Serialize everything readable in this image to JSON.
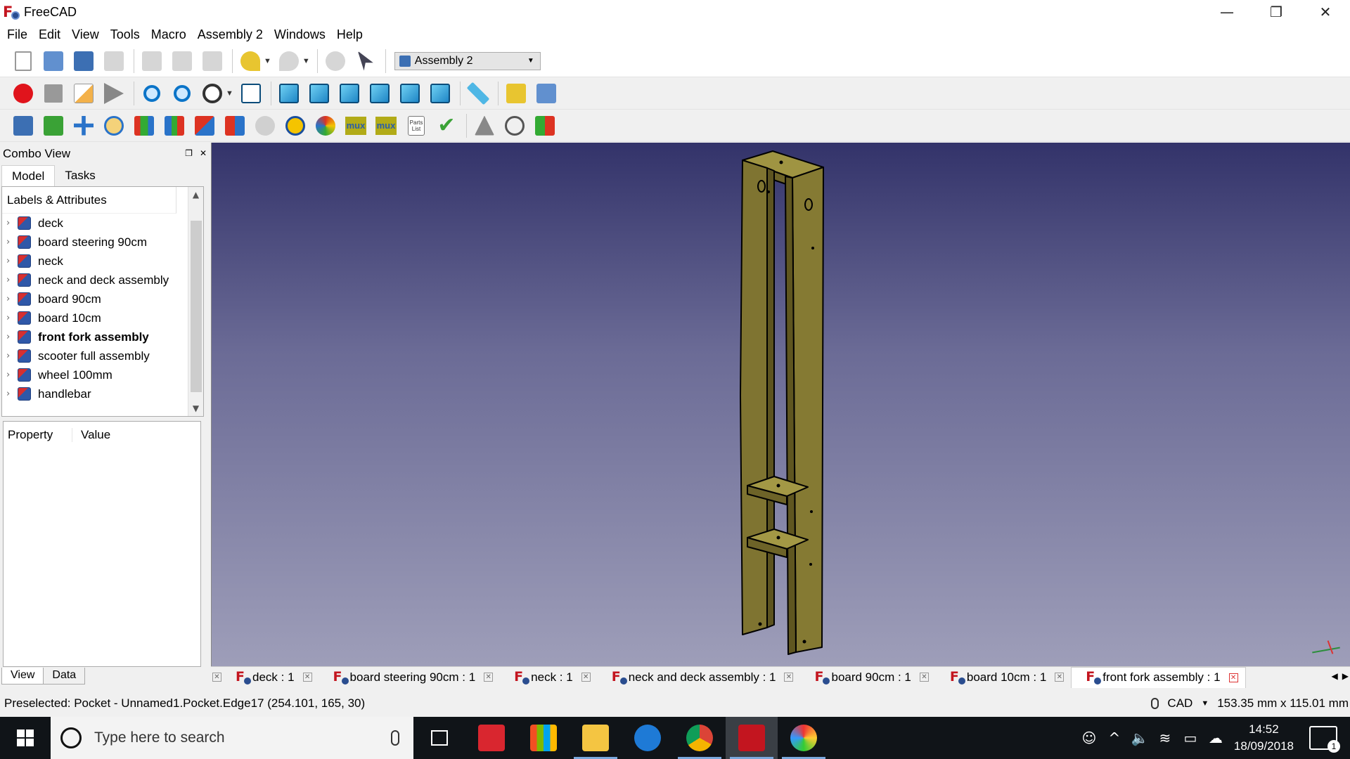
{
  "window": {
    "title": "FreeCAD",
    "controls": [
      "—",
      "❐",
      "✕"
    ]
  },
  "menu": [
    "File",
    "Edit",
    "View",
    "Tools",
    "Macro",
    "Assembly 2",
    "Windows",
    "Help"
  ],
  "toolbar": {
    "workbench_selector": "Assembly 2",
    "row1_icons": [
      "new-document-icon",
      "open-icon",
      "save-icon",
      "save-as-icon",
      "cut-icon",
      "copy-icon",
      "paste-icon",
      "undo-icon",
      "redo-icon",
      "refresh-icon",
      "whats-this-icon"
    ],
    "row2_icons": [
      "record-macro-icon",
      "stop-macro-icon",
      "edit-macro-icon",
      "run-macro-icon",
      "fit-all-icon",
      "fit-selection-icon",
      "draw-style-icon",
      "isometric-view-icon",
      "front-view-icon",
      "top-view-icon",
      "right-view-icon",
      "rear-view-icon",
      "bottom-view-icon",
      "left-view-icon",
      "measure-icon",
      "part-icon",
      "group-icon"
    ],
    "row3_icons": [
      "import-part-icon",
      "update-parts-icon",
      "move-part-icon",
      "circular-edge-constraint-icon",
      "plane-constraint-icon",
      "axial-constraint-icon",
      "angle-constraint-icon",
      "spherical-constraint-icon",
      "undo-constraint-icon",
      "solve-icon",
      "animate-icon",
      "mux-icon",
      "mux-update-icon",
      "parts-list-icon",
      "check-assembly-icon",
      "mirror-icon",
      "degrees-of-freedom-icon",
      "label-icon"
    ],
    "mux_label": "mux",
    "parts_list_label": "Parts List"
  },
  "combo_view": {
    "title": "Combo View",
    "tabs": [
      "Model",
      "Tasks"
    ],
    "tree_header": "Labels & Attributes",
    "tree_items": [
      {
        "label": "deck",
        "bold": false
      },
      {
        "label": "board steering 90cm",
        "bold": false
      },
      {
        "label": "neck",
        "bold": false
      },
      {
        "label": "neck and deck assembly",
        "bold": false
      },
      {
        "label": "board 90cm",
        "bold": false
      },
      {
        "label": "board 10cm",
        "bold": false
      },
      {
        "label": "front fork assembly",
        "bold": true
      },
      {
        "label": "scooter full assembly",
        "bold": false
      },
      {
        "label": "wheel 100mm",
        "bold": false
      },
      {
        "label": "handlebar",
        "bold": false
      }
    ],
    "property_header": "Property",
    "value_header": "Value",
    "bottom_tabs": [
      "View",
      "Data"
    ]
  },
  "document_tabs": [
    {
      "label": "deck : 1",
      "active": false
    },
    {
      "label": "board steering 90cm : 1",
      "active": false
    },
    {
      "label": "neck : 1",
      "active": false
    },
    {
      "label": "neck and deck assembly : 1",
      "active": false
    },
    {
      "label": "board 90cm : 1",
      "active": false
    },
    {
      "label": "board 10cm : 1",
      "active": false
    },
    {
      "label": "front fork assembly : 1",
      "active": true
    }
  ],
  "status": {
    "message": "Preselected: Pocket - Unnamed1.Pocket.Edge17 (254.101, 165, 30)",
    "nav_style": "CAD",
    "dimensions": "153.35 mm x 115.01 mm"
  },
  "taskbar": {
    "search_placeholder": "Type here to search",
    "time": "14:52",
    "date": "18/09/2018",
    "notification_count": "1"
  },
  "colors": {
    "view_top": "#33336a",
    "view_bottom": "#9e9eb9",
    "wood": "#7f7431",
    "freecad_red": "#c3151f"
  }
}
